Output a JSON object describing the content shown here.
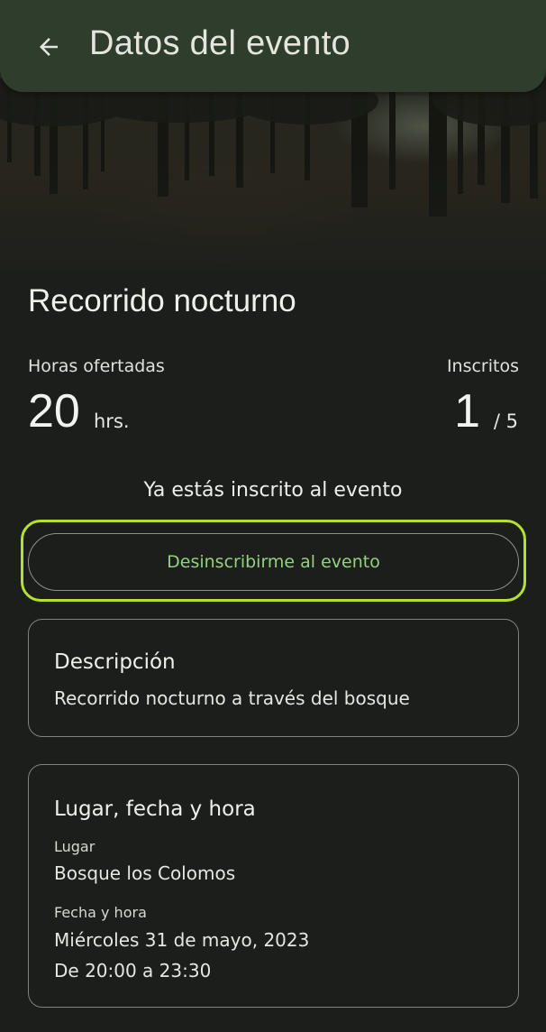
{
  "app_bar": {
    "title": "Datos del evento",
    "back_icon": "arrow-left-icon",
    "background": "#2f3d2d"
  },
  "hero": {
    "image": "forest-at-dusk"
  },
  "event": {
    "title": "Recorrido nocturno",
    "hours_label": "Horas ofertadas",
    "hours_value": "20",
    "hours_unit": "hrs.",
    "enrolled_label": "Inscritos",
    "enrolled_value": "1",
    "enrolled_total": "/ 5"
  },
  "status": {
    "message": "Ya estás inscrito al evento",
    "unsubscribe_label": "Desinscribirme al evento",
    "accent": "#93d17f",
    "focus_color": "#b6e030"
  },
  "description_card": {
    "heading": "Descripción",
    "text": "Recorrido nocturno a través del bosque"
  },
  "place_card": {
    "heading": "Lugar, fecha y hora",
    "place_label": "Lugar",
    "place_value": "Bosque los Colomos",
    "datetime_label": "Fecha y hora",
    "date_value": "Miércoles 31 de mayo, 2023",
    "time_value": "De 20:00 a 23:30"
  }
}
